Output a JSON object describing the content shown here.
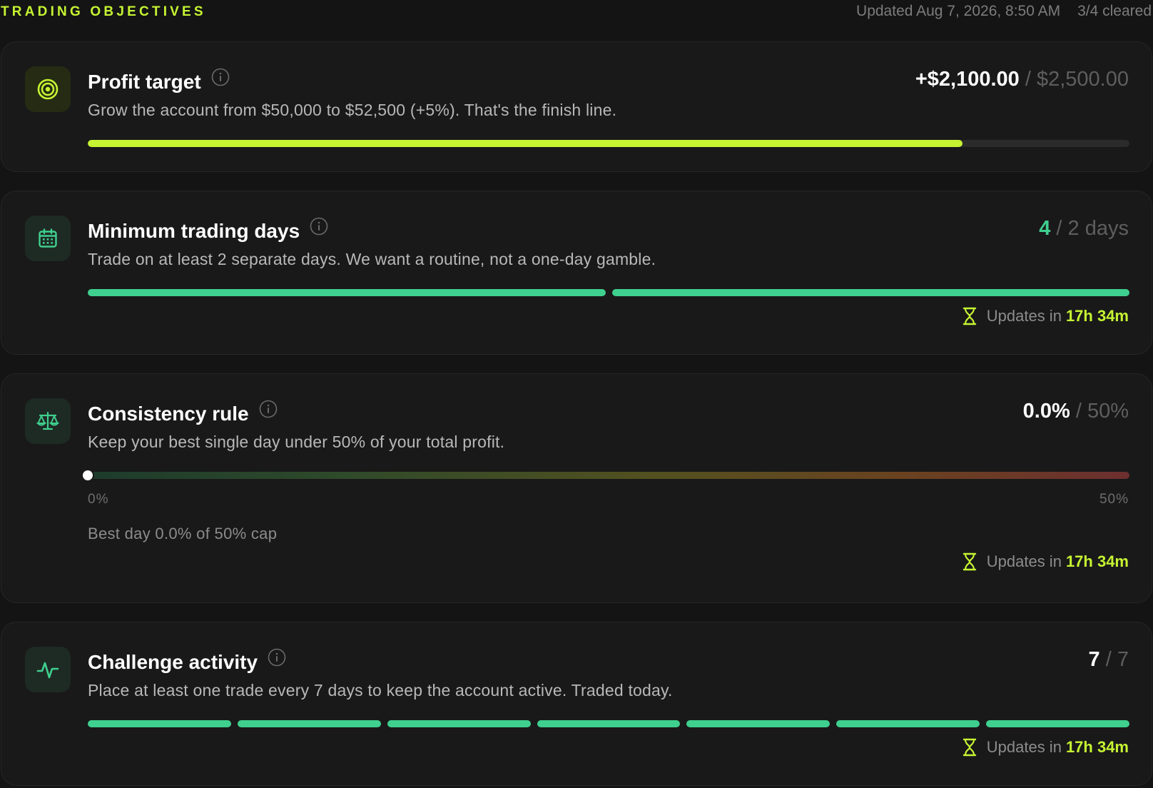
{
  "header": {
    "title": "TRADING OBJECTIVES",
    "updated": "Updated Aug 7, 2026, 8:50 AM",
    "cleared": "3/4 cleared"
  },
  "colors": {
    "accent_lime": "#c6f432",
    "accent_green": "#3fcf8e",
    "background": "#141414",
    "card": "#191919"
  },
  "objectives": [
    {
      "icon": "target-icon",
      "title": "Profit target",
      "description": "Grow the account from $50,000 to $52,500 (+5%). That's the finish line.",
      "current": "+$2,100.00",
      "separator": "/",
      "target": "$2,500.00",
      "progress": 0.84
    },
    {
      "icon": "calendar-icon",
      "title": "Minimum trading days",
      "description": "Trade on at least 2 separate days. We want a routine, not a one-day gamble.",
      "current": "4",
      "separator": "/",
      "target": "2 days",
      "segments_total": 2,
      "segments_filled": 2,
      "updates_label": "Updates in",
      "updates_time": "17h 34m"
    },
    {
      "icon": "scale-icon",
      "title": "Consistency rule",
      "description": "Keep your best single day under 50% of your total profit.",
      "current": "0.0%",
      "separator": "/",
      "target": "50%",
      "level_fraction": 0.0,
      "scale_min": "0%",
      "scale_max": "50%",
      "best_day": "Best day 0.0% of 50% cap",
      "updates_label": "Updates in",
      "updates_time": "17h 34m"
    },
    {
      "icon": "activity-icon",
      "title": "Challenge activity",
      "description": "Place at least one trade every 7 days to keep the account active. Traded today.",
      "current": "7",
      "separator": "/",
      "target": "7",
      "segments_total": 7,
      "segments_filled": 7,
      "updates_label": "Updates in",
      "updates_time": "17h 34m"
    }
  ]
}
